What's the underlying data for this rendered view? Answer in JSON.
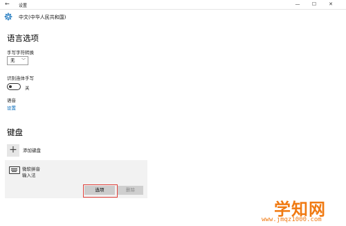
{
  "titlebar": {
    "back_icon": "arrow-left-icon",
    "title": "设置",
    "min": "—",
    "max": "☐",
    "close": "✕"
  },
  "header": {
    "icon": "gear-icon",
    "text": "中文(中华人民共和国)"
  },
  "language_options": {
    "title": "语言选项",
    "handwriting_conversion_label": "手写字符转换",
    "handwriting_conversion_value": "无",
    "recognize_cursive_label": "识别连体手写",
    "recognize_cursive_state": "关",
    "voice_label": "语音",
    "voice_link": "设置"
  },
  "keyboard": {
    "title": "键盘",
    "add_keyboard": "添加键盘",
    "ime_name": "微软拼音",
    "ime_type": "输入法",
    "options_button": "选项",
    "remove_button": "删除"
  },
  "watermark": {
    "brand": "学知网",
    "url": "www.jmqz1000.com"
  },
  "colors": {
    "link": "#0067b8",
    "highlight": "#e0403a",
    "watermark": "#f07a12"
  }
}
